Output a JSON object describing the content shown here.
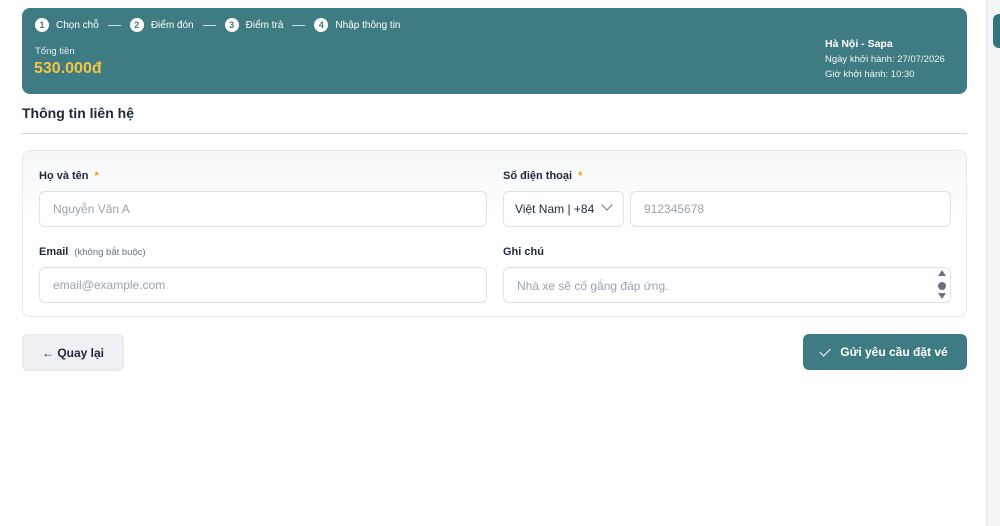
{
  "steps": [
    {
      "num": "1",
      "label": "Chọn chỗ"
    },
    {
      "num": "2",
      "label": "Điểm đón"
    },
    {
      "num": "3",
      "label": "Điểm trả"
    },
    {
      "num": "4",
      "label": "Nhập thông tin"
    }
  ],
  "summary": {
    "total_label": "Tổng tiền",
    "total_value": "530.000đ",
    "route": "Hà Nội - Sapa",
    "departure_date": "Ngày khởi hành: 27/07/2026",
    "departure_time": "Giờ khởi hành: 10:30"
  },
  "section": {
    "title": "Thông tin liên hệ"
  },
  "form": {
    "name": {
      "label": "Họ và tên",
      "required_mark": "*",
      "placeholder": "Nguyễn Văn A"
    },
    "phone": {
      "label": "Số điện thoại",
      "required_mark": "*",
      "country_value": "Việt Nam | +84",
      "placeholder": "912345678"
    },
    "email": {
      "label": "Email",
      "optional_note": "(không bắt buộc)",
      "placeholder": "email@example.com"
    },
    "note": {
      "label": "Ghi chú",
      "placeholder": "Nhà xe sẽ cố gắng đáp ứng."
    }
  },
  "actions": {
    "back_label": "← Quay lại",
    "submit_label": "Gửi yêu cầu đặt vé"
  },
  "colors": {
    "primary": "#3f7b82",
    "total_accent": "#f5c542",
    "required_accent": "#f59e0b"
  }
}
